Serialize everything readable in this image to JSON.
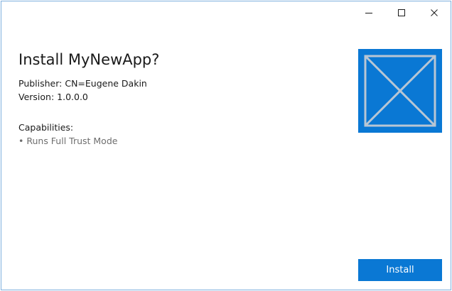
{
  "window": {
    "caption_buttons": {
      "minimize_icon": "minimize-icon",
      "maximize_icon": "maximize-icon",
      "close_icon": "close-icon"
    }
  },
  "installer": {
    "title": "Install MyNewApp?",
    "publisher": "Publisher: CN=Eugene Dakin",
    "version": "Version: 1.0.0.0",
    "capabilities_header": "Capabilities:",
    "capabilities": [
      "• Runs Full Trust Mode"
    ],
    "install_label": "Install",
    "logo_icon": "placeholder-logo-icon"
  },
  "colors": {
    "accent": "#0a78d4",
    "logo_lines": "#b8c6d4",
    "window_border": "#7fb0de"
  }
}
